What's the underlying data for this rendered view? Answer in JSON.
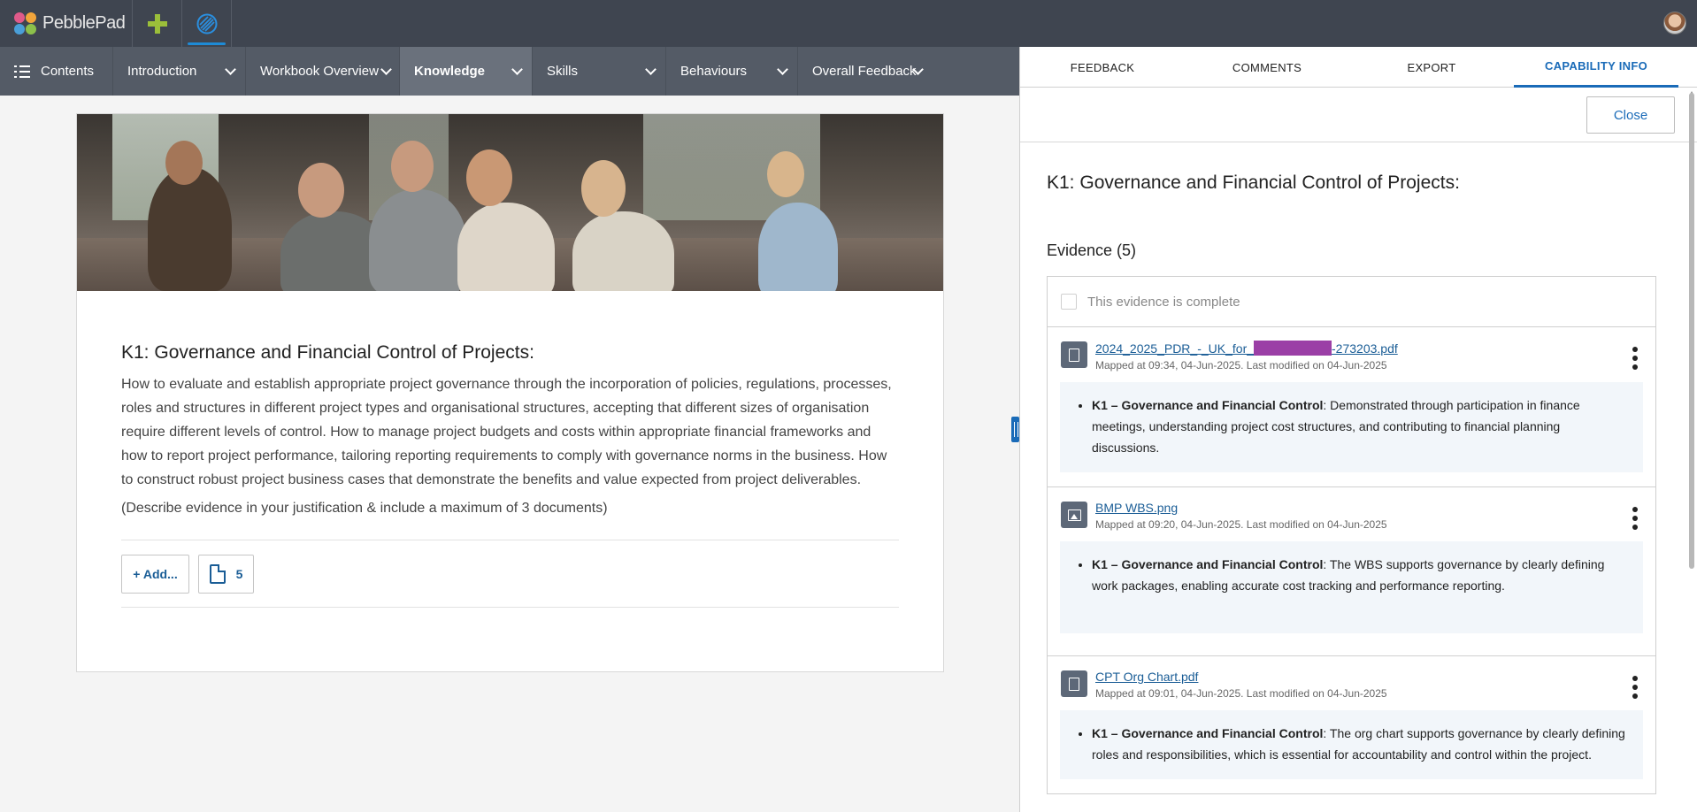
{
  "app": {
    "name": "PebblePad"
  },
  "navbar": {
    "items": [
      {
        "label": "Contents"
      },
      {
        "label": "Introduction"
      },
      {
        "label": "Workbook Overview"
      },
      {
        "label": "Knowledge"
      },
      {
        "label": "Skills"
      },
      {
        "label": "Behaviours"
      },
      {
        "label": "Overall Feedback"
      }
    ],
    "active": "Knowledge"
  },
  "card": {
    "title": "K1: Governance and Financial Control of Projects:",
    "description": "How to evaluate and establish appropriate project governance through the incorporation of policies, regulations, processes, roles and structures in different project types and organisational structures, accepting that different sizes of organisation require different levels of control. How to manage project budgets and costs within appropriate financial frameworks and how to report project performance, tailoring reporting requirements to comply with governance norms in the business. How to construct robust project business cases that demonstrate the benefits and value expected from project deliverables.",
    "note": "(Describe evidence in your justification & include a maximum of 3 documents)",
    "add_label": "+ Add...",
    "evidence_count": "5"
  },
  "panel": {
    "tabs": [
      {
        "label": "FEEDBACK"
      },
      {
        "label": "COMMENTS"
      },
      {
        "label": "EXPORT"
      },
      {
        "label": "CAPABILITY INFO"
      }
    ],
    "active_tab": "CAPABILITY INFO",
    "close_label": "Close",
    "title": "K1: Governance and Financial Control of Projects:",
    "evidence_heading": "Evidence (5)",
    "complete_label": "This evidence is complete",
    "complete_checked": false,
    "evidence": [
      {
        "icon": "pdf-file-icon",
        "name_prefix": "2024_2025_PDR_-_UK_for_",
        "name_suffix": "-273203.pdf",
        "redacted": true,
        "meta": "Mapped at 09:34, 04-Jun-2025. Last modified on 04-Jun-2025",
        "justification_bold": "K1 – Governance and Financial Control",
        "justification_text": ": Demonstrated through participation in finance meetings, understanding project cost structures, and contributing to financial planning discussions."
      },
      {
        "icon": "image-file-icon",
        "name": "BMP WBS.png",
        "meta": "Mapped at 09:20, 04-Jun-2025. Last modified on 04-Jun-2025",
        "justification_bold": "K1 – Governance and Financial Control",
        "justification_text": ": The WBS supports governance by clearly defining work packages, enabling accurate cost tracking and performance reporting."
      },
      {
        "icon": "pdf-file-icon",
        "name": "CPT Org Chart.pdf",
        "meta": "Mapped at 09:01, 04-Jun-2025. Last modified on 04-Jun-2025",
        "justification_bold": "K1 – Governance and Financial Control",
        "justification_text": ": The org chart supports governance by clearly defining roles and responsibilities, which is essential for accountability and control within the project."
      }
    ]
  },
  "colors": {
    "topbar": "#3f4550",
    "navbar": "#545b66",
    "accent": "#1a6bb8",
    "link": "#1a5d96",
    "redaction": "#9b3fa6"
  }
}
